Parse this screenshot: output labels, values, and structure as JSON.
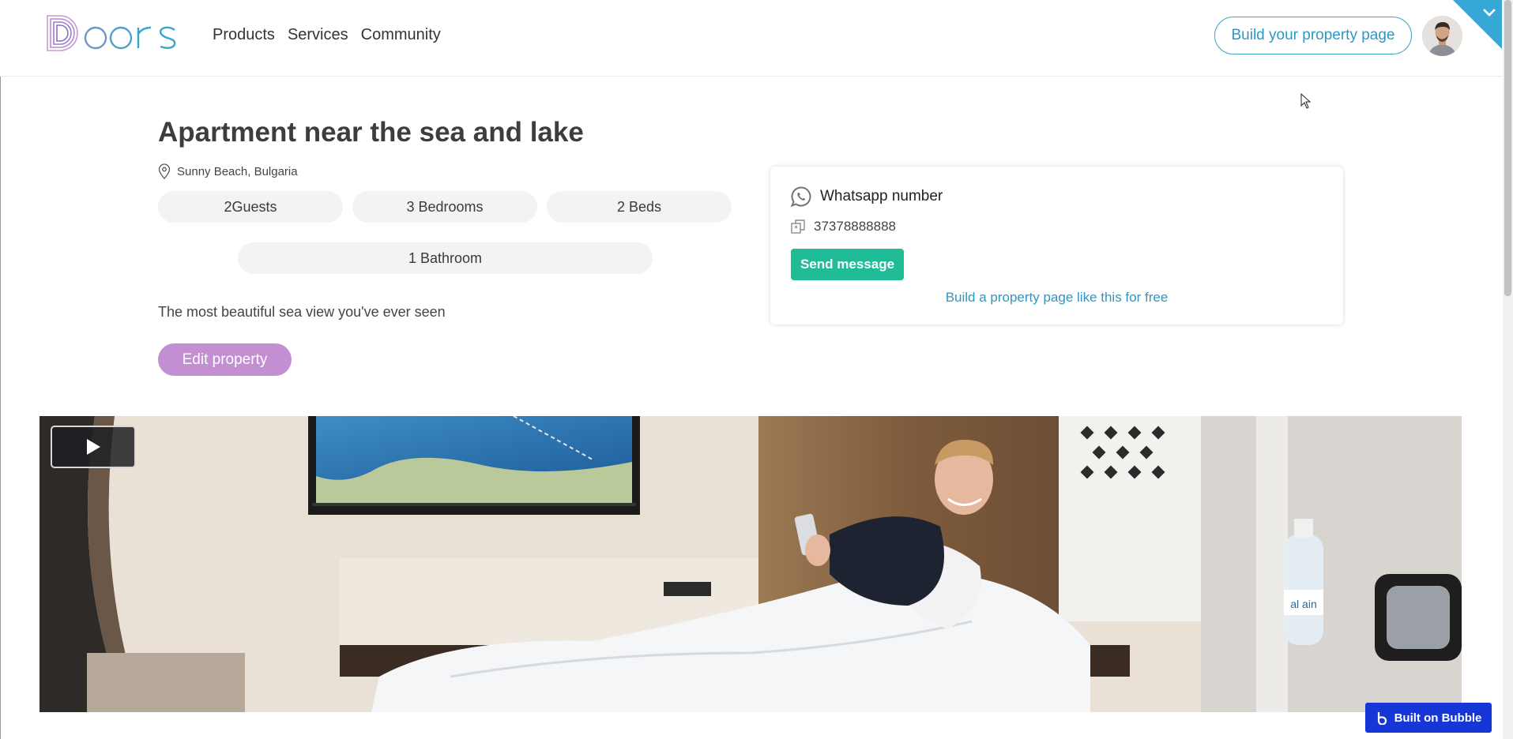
{
  "header": {
    "logo_text": "Doors",
    "nav": [
      "Products",
      "Services",
      "Community"
    ],
    "build_button": "Build your property page"
  },
  "property": {
    "title": "Apartment near the sea and lake",
    "location": "Sunny Beach, Bulgaria",
    "features": [
      "2Guests",
      "3 Bedrooms",
      "2 Beds",
      "1 Bathroom"
    ],
    "description": "The most beautiful sea view you've ever seen",
    "edit_button": "Edit property"
  },
  "contact": {
    "title": "Whatsapp number",
    "phone": "37378888888",
    "send_button": "Send message",
    "free_link": "Build a property page like this for free"
  },
  "badge": {
    "label": "Built on Bubble"
  },
  "icons": {
    "location": "location-pin-icon",
    "whatsapp": "whatsapp-icon",
    "copy": "copy-icon",
    "play": "play-icon",
    "chevron": "chevron-down-icon",
    "bubble": "bubble-logo-icon"
  },
  "colors": {
    "accent_blue": "#2f97c1",
    "edit_purple": "#c290d2",
    "send_green": "#1fbc95",
    "bubble_blue": "#1736d6",
    "logo_purple": "#a77fc4"
  }
}
